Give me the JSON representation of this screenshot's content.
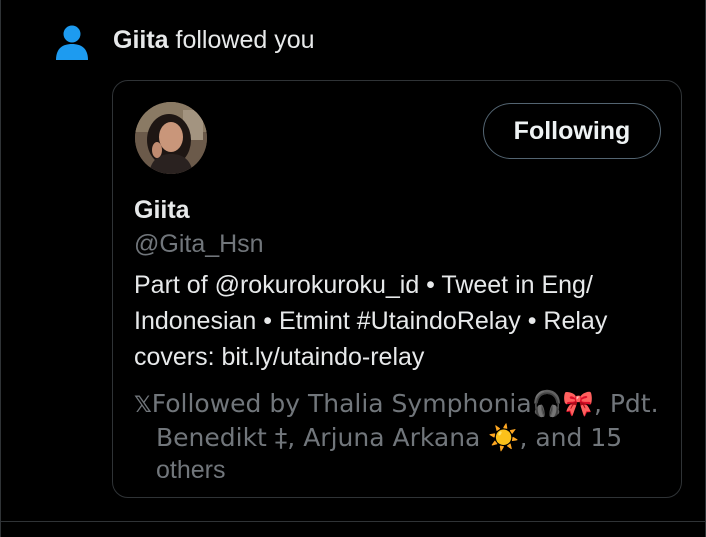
{
  "notification": {
    "icon": "person-icon",
    "actor_name": "Giita",
    "action_text": "followed you",
    "icon_color": "#1d9bf0"
  },
  "profile_card": {
    "display_name": "Giita",
    "handle": "@Gita_Hsn",
    "follow_button_label": "Following",
    "bio_lines": [
      "Part of @rokurokuroku_id • Tweet in Eng/",
      "Indonesian • Etmint #UtaindoRelay • Relay",
      "covers: bit.ly/utaindo-relay"
    ],
    "followed_by": {
      "x_logo": "𝕏",
      "line1": "Followed by Thalia Symphonia🎧🎀, Pdt.",
      "line2": "Benedikt ‡, Arjuna Arkana ☀️, and 15",
      "line3": "others"
    }
  },
  "colors": {
    "background": "#000000",
    "text_primary": "#e7e9ea",
    "text_secondary": "#71767b",
    "border": "#2f3336",
    "accent": "#1d9bf0"
  }
}
